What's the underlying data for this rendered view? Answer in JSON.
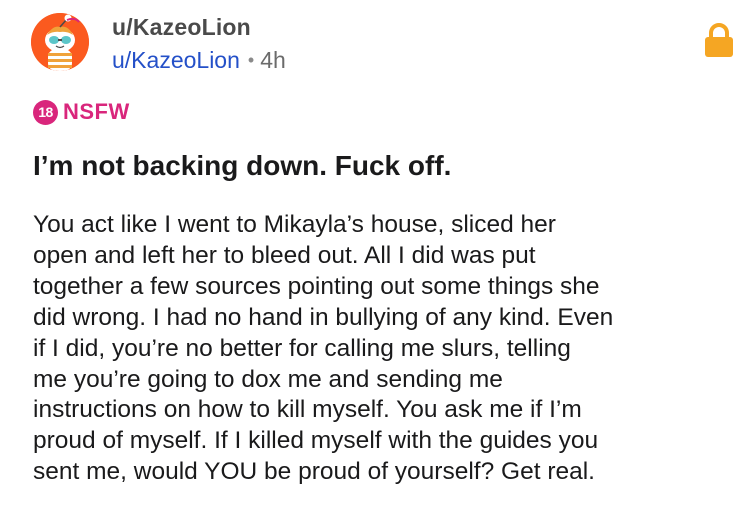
{
  "post": {
    "header": {
      "display_name": "u/KazeoLion",
      "username": "u/KazeoLion",
      "separator": "•",
      "time": "4h"
    },
    "nsfw": {
      "badge": "18",
      "label": "NSFW"
    },
    "title": "I’m not backing down. Fuck off.",
    "body_lines": [
      "You act like I went to Mikayla’s house, sliced her",
      "open and left her to bleed out. All I did was put",
      "together a few sources pointing out some things she",
      "did wrong. I had no hand in bullying of any kind. Even",
      "if I did, you’re no better for calling me slurs, telling",
      "me you’re going to dox me and sending me",
      "instructions on how to kill myself. You ask me if I’m",
      "proud of myself. If I killed myself with the guides you",
      "sent me, would YOU be proud of yourself? Get real."
    ]
  },
  "icons": {
    "avatar": "snoo-tiger-avatar",
    "lock": "lock-icon"
  },
  "colors": {
    "avatar_bg": "#fb5a1f",
    "username_link": "#2450c8",
    "nsfw": "#d9267c",
    "lock": "#f5a623",
    "text": "#1a1a1b"
  }
}
